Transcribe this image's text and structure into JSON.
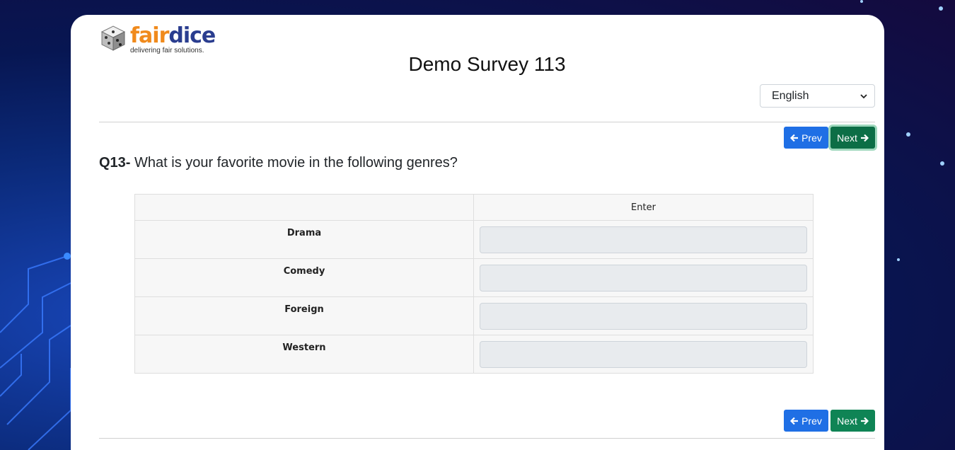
{
  "brand": {
    "name_part1": "fair",
    "name_part2": "dice",
    "tagline": "delivering fair solutions."
  },
  "survey": {
    "title": "Demo Survey 113"
  },
  "language": {
    "selected": "English"
  },
  "nav": {
    "prev_label": "Prev",
    "next_label": "Next"
  },
  "question": {
    "number": "Q13-",
    "text": "What is your favorite movie in the following genres?"
  },
  "grid": {
    "column_header": "Enter",
    "rows": [
      {
        "label": "Drama",
        "value": ""
      },
      {
        "label": "Comedy",
        "value": ""
      },
      {
        "label": "Foreign",
        "value": ""
      },
      {
        "label": "Western",
        "value": ""
      }
    ]
  },
  "colors": {
    "prev_button": "#1f6fe5",
    "next_button": "#0f8455",
    "brand_orange": "#f08a1c",
    "brand_navy": "#2a3d8f"
  }
}
